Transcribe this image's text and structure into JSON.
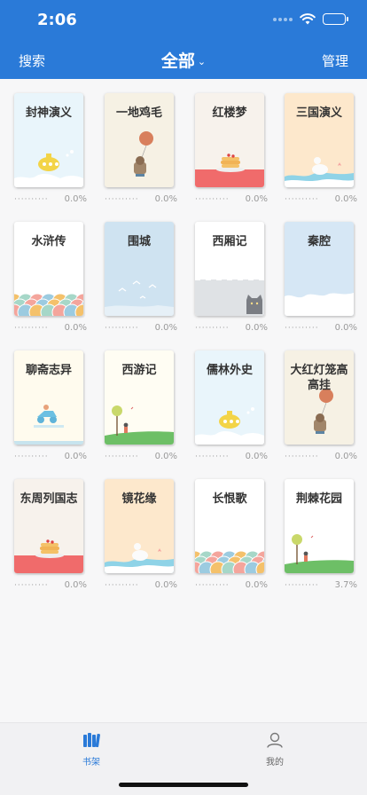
{
  "status": {
    "time": "2:06"
  },
  "nav": {
    "left": "搜索",
    "title": "全部",
    "right": "管理"
  },
  "books": [
    {
      "title": "封神演义",
      "progress": "0.0%",
      "cover": "sub-cloud",
      "bg": "#e9f5fb"
    },
    {
      "title": "一地鸡毛",
      "progress": "0.0%",
      "cover": "balloon-cat",
      "bg": "#f6f1e4"
    },
    {
      "title": "红楼梦",
      "progress": "0.0%",
      "cover": "pancake",
      "bg": "#f7f2ec"
    },
    {
      "title": "三国演义",
      "progress": "0.0%",
      "cover": "bird-wave",
      "bg": "#fde8cc"
    },
    {
      "title": "水浒传",
      "progress": "0.0%",
      "cover": "scallops",
      "bg": "#ffffff"
    },
    {
      "title": "围城",
      "progress": "0.0%",
      "cover": "birds-sky",
      "bg": "#cfe3f1"
    },
    {
      "title": "西厢记",
      "progress": "0.0%",
      "cover": "grey-cat",
      "bg": "#ffffff"
    },
    {
      "title": "秦腔",
      "progress": "0.0%",
      "cover": "cloud-blue",
      "bg": "#d6e7f5"
    },
    {
      "title": "聊斋志异",
      "progress": "0.0%",
      "cover": "scooter",
      "bg": "#fffbee"
    },
    {
      "title": "西游记",
      "progress": "0.0%",
      "cover": "tree-hill",
      "bg": "#fffdf3"
    },
    {
      "title": "儒林外史",
      "progress": "0.0%",
      "cover": "sub-cloud",
      "bg": "#e9f5fb"
    },
    {
      "title": "大红灯笼高高挂",
      "progress": "0.0%",
      "cover": "balloon-cat",
      "bg": "#f6f1e4"
    },
    {
      "title": "东周列国志",
      "progress": "0.0%",
      "cover": "pancake",
      "bg": "#f7f2ec"
    },
    {
      "title": "镜花缘",
      "progress": "0.0%",
      "cover": "bird-wave",
      "bg": "#fde8cc"
    },
    {
      "title": "长恨歌",
      "progress": "0.0%",
      "cover": "scallops",
      "bg": "#ffffff"
    },
    {
      "title": "荆棘花园",
      "progress": "3.7%",
      "cover": "tree-hill",
      "bg": "#ffffff"
    }
  ],
  "tabs": [
    {
      "label": "书架",
      "icon": "bookshelf-icon",
      "active": true
    },
    {
      "label": "我的",
      "icon": "person-icon",
      "active": false
    }
  ],
  "colors": {
    "primary": "#2a7ad8",
    "text_muted": "#9a9a9a"
  }
}
